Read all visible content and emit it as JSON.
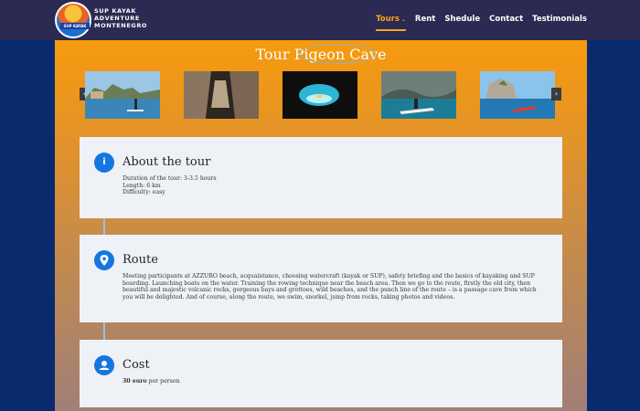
{
  "brand": {
    "line1": "SUP KAYAK",
    "line2": "ADVENTURE",
    "line3": "MONTENEGRO",
    "logo_band": "SUP KAYAK"
  },
  "nav": [
    {
      "label": "Tours",
      "active": true
    },
    {
      "label": "Rent"
    },
    {
      "label": "Shedule"
    },
    {
      "label": "Contact"
    },
    {
      "label": "Testimonials"
    }
  ],
  "colors": {
    "accent": "#ffa21c",
    "header_bg": "#2a2a52",
    "page_bg": "#0a2a6e",
    "icon_blue": "#1676e0"
  },
  "tour": {
    "title": "Tour Pigeon Cave"
  },
  "sections": {
    "about": {
      "title": "About the tour",
      "icon": "info-icon",
      "lines": [
        "Duration of the tour: 3-3.5 hours",
        "Length: 6 km",
        "Difficulty: easy"
      ]
    },
    "route": {
      "title": "Route",
      "icon": "map-pin-icon",
      "text": "Meeting participants at AZZURO beach, acquaintance, choosing watercraft (kayak or SUP), safety briefing and the basics of kayaking and SUP boarding. Launching boats on the water. Training the rowing technique near the beach area. Then we go to the route, firstly the old city, then beautiful and majestic volcanic rocks, gorgeous bays and grottoes, wild beaches, and the punch line of the route – is a passage cave from which you will be delighted. And of course, along the route, we swim, snorkel, jump from rocks, taking photos and videos."
    },
    "cost": {
      "title": "Cost",
      "icon": "user-circle-icon",
      "price": "30 euro",
      "suffix": " per person"
    }
  }
}
